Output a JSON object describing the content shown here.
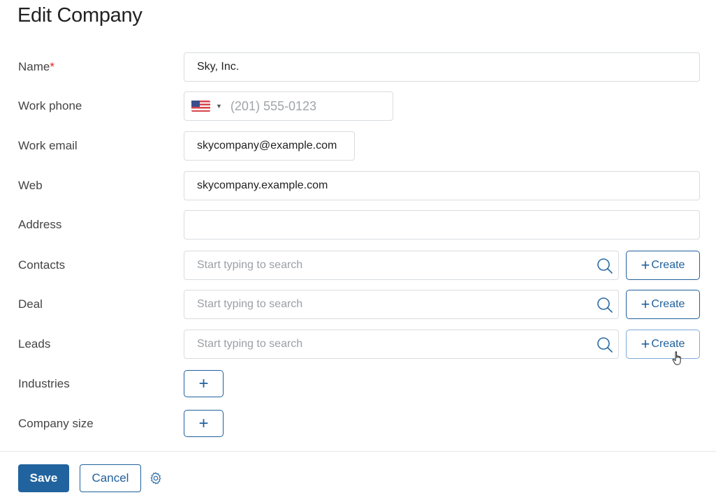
{
  "page": {
    "title": "Edit Company"
  },
  "form": {
    "name": {
      "label": "Name",
      "required_mark": "*",
      "value": "Sky, Inc."
    },
    "work_phone": {
      "label": "Work phone",
      "country": "US",
      "placeholder": "(201) 555-0123"
    },
    "work_email": {
      "label": "Work email",
      "value": "skycompany@example.com"
    },
    "web": {
      "label": "Web",
      "value": "skycompany.example.com"
    },
    "address": {
      "label": "Address",
      "value": ""
    },
    "contacts": {
      "label": "Contacts",
      "placeholder": "Start typing to search",
      "create_label": "Create"
    },
    "deal": {
      "label": "Deal",
      "placeholder": "Start typing to search",
      "create_label": "Create"
    },
    "leads": {
      "label": "Leads",
      "placeholder": "Start typing to search",
      "create_label": "Create"
    },
    "industries": {
      "label": "Industries",
      "add_label": "+"
    },
    "company_size": {
      "label": "Company size",
      "add_label": "+"
    }
  },
  "footer": {
    "save_label": "Save",
    "cancel_label": "Cancel"
  },
  "colors": {
    "accent": "#21639e",
    "required": "#e02424"
  }
}
